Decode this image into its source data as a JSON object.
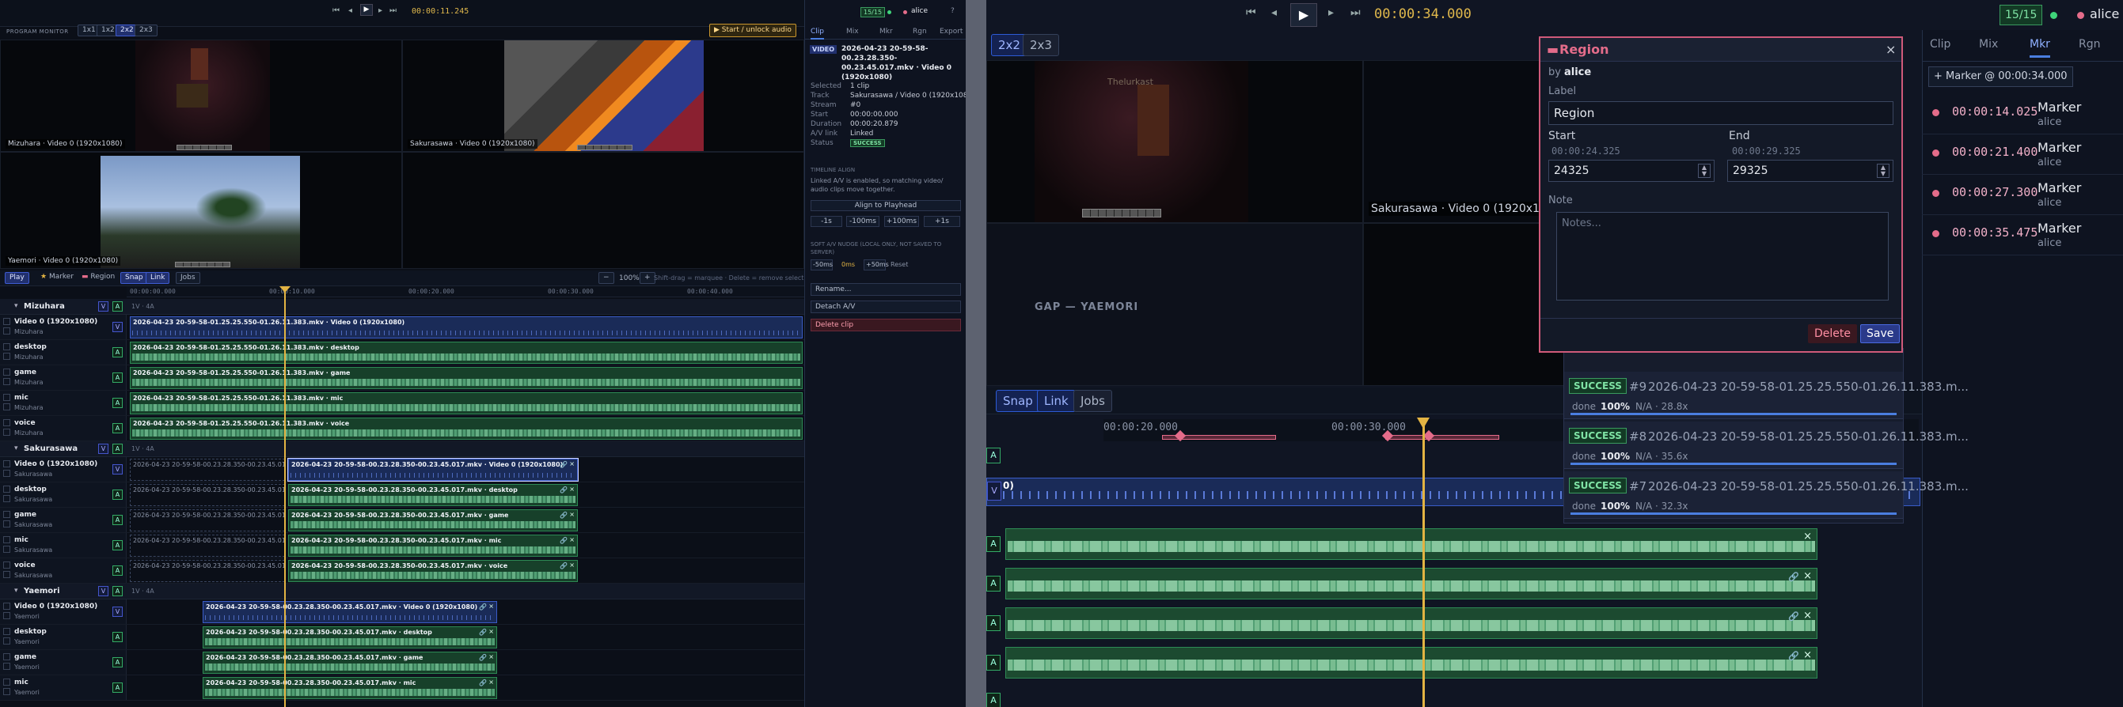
{
  "transport": {
    "timecode_left": "00:00:11.245",
    "timecode_right": "00:00:34.000",
    "count": "15/15",
    "user": "alice",
    "help": "?"
  },
  "monitor": {
    "label": "PROGRAM MONITOR",
    "layouts": [
      "1x1",
      "1x2",
      "2x2",
      "2x3"
    ],
    "start_btn": "▶ Start / unlock audio",
    "tiles": [
      "Mizuhara · Video 0 (1920x1080)",
      "Sakurasawa · Video 0 (1920x1080)",
      "Yaemori · Video 0 (1920x1080)"
    ],
    "gap_label": "GAP — YAEMORI",
    "magnified_tile": "Sakurasawa · Video 0 (1920x1080)",
    "game_hud": "Thelurkast"
  },
  "toolbar": {
    "play": "Play",
    "marker": "Marker",
    "region": "Region",
    "snap": "Snap",
    "link": "Link",
    "jobs": "Jobs",
    "zoom": "100%",
    "hint": "Shift-drag = marquee · Delete = remove selection"
  },
  "ruler": [
    "00:00:00.000",
    "00:00:10.000",
    "00:00:20.000",
    "00:00:30.000",
    "00:00:40.000"
  ],
  "groups": [
    {
      "name": "Mizuhara",
      "info": "1V · 4A",
      "tracks": [
        {
          "name": "Video 0 (1920x1080)",
          "sub": "Mizuhara",
          "kind": "V",
          "clip": "2026-04-23 20-59-58-01.25.25.550-01.26.11.383.mkv · Video 0 (1920x1080)"
        },
        {
          "name": "desktop",
          "sub": "Mizuhara",
          "kind": "A",
          "clip": "2026-04-23 20-59-58-01.25.25.550-01.26.11.383.mkv · desktop"
        },
        {
          "name": "game",
          "sub": "Mizuhara",
          "kind": "A",
          "clip": "2026-04-23 20-59-58-01.25.25.550-01.26.11.383.mkv · game"
        },
        {
          "name": "mic",
          "sub": "Mizuhara",
          "kind": "A",
          "clip": "2026-04-23 20-59-58-01.25.25.550-01.26.11.383.mkv · mic"
        },
        {
          "name": "voice",
          "sub": "Mizuhara",
          "kind": "A",
          "clip": "2026-04-23 20-59-58-01.25.25.550-01.26.11.383.mkv · voice"
        }
      ]
    },
    {
      "name": "Sakurasawa",
      "info": "1V · 4A",
      "tracks": [
        {
          "name": "Video 0 (1920x1080)",
          "sub": "Sakurasawa",
          "kind": "V",
          "ghost": "2026-04-23 20-59-58-00.23.28.350-00.23.45.017.mkv",
          "clip": "2026-04-23 20-59-58-00.23.28.350-00.23.45.017.mkv · Video 0 (1920x1080)"
        },
        {
          "name": "desktop",
          "sub": "Sakurasawa",
          "kind": "A",
          "ghost": "2026-04-23 20-59-58-00.23.28.350-00.23.45.017.mkv",
          "clip": "2026-04-23 20-59-58-00.23.28.350-00.23.45.017.mkv · desktop"
        },
        {
          "name": "game",
          "sub": "Sakurasawa",
          "kind": "A",
          "ghost": "2026-04-23 20-59-58-00.23.28.350-00.23.45.017.mkv",
          "clip": "2026-04-23 20-59-58-00.23.28.350-00.23.45.017.mkv · game"
        },
        {
          "name": "mic",
          "sub": "Sakurasawa",
          "kind": "A",
          "ghost": "2026-04-23 20-59-58-00.23.28.350-00.23.45.017.mkv",
          "clip": "2026-04-23 20-59-58-00.23.28.350-00.23.45.017.mkv · mic"
        },
        {
          "name": "voice",
          "sub": "Sakurasawa",
          "kind": "A",
          "ghost": "2026-04-23 20-59-58-00.23.28.350-00.23.45.017.mkv",
          "clip": "2026-04-23 20-59-58-00.23.28.350-00.23.45.017.mkv · voice"
        }
      ]
    },
    {
      "name": "Yaemori",
      "info": "1V · 4A",
      "tracks": [
        {
          "name": "Video 0 (1920x1080)",
          "sub": "Yaemori",
          "kind": "V",
          "clip": "2026-04-23 20-59-58-00.23.28.350-00.23.45.017.mkv · Video 0 (1920x1080)"
        },
        {
          "name": "desktop",
          "sub": "Yaemori",
          "kind": "A",
          "clip": "2026-04-23 20-59-58-00.23.28.350-00.23.45.017.mkv · desktop"
        },
        {
          "name": "game",
          "sub": "Yaemori",
          "kind": "A",
          "clip": "2026-04-23 20-59-58-00.23.28.350-00.23.45.017.mkv · game"
        },
        {
          "name": "mic",
          "sub": "Yaemori",
          "kind": "A",
          "clip": "2026-04-23 20-59-58-00.23.28.350-00.23.45.017.mkv · mic"
        }
      ]
    }
  ],
  "panel": {
    "tabs": [
      "Clip",
      "Mix",
      "Mkr",
      "Rgn",
      "Export"
    ],
    "badge": "VIDEO",
    "file": "2026-04-23 20-59-58-00.23.28.350-00.23.45.017.mkv · Video 0 (1920x1080)",
    "props": [
      [
        "Selected",
        "1 clip"
      ],
      [
        "Track",
        "Sakurasawa / Video 0 (1920x108..."
      ],
      [
        "Stream",
        "#0"
      ],
      [
        "Start",
        "00:00:00.000"
      ],
      [
        "Duration",
        "00:00:20.879"
      ],
      [
        "A/V link",
        "Linked"
      ],
      [
        "Status",
        "SUCCESS"
      ]
    ],
    "align_title": "TIMELINE ALIGN",
    "align_text": "Linked A/V is enabled, so matching video/ audio clips move together.",
    "align_btn": "Align to Playhead",
    "nudges": [
      "-1s",
      "-100ms",
      "+100ms",
      "+1s"
    ],
    "soft_title": "SOFT A/V NUDGE (LOCAL ONLY, NOT SAVED TO SERVER)",
    "soft": [
      "-50ms",
      "0ms",
      "+50ms",
      "Reset"
    ],
    "rename": "Rename...",
    "detach": "Detach A/V",
    "delete": "Delete clip"
  },
  "right": {
    "tabs": [
      "Clip",
      "Mix",
      "Mkr",
      "Rgn"
    ],
    "add_marker": "+ Marker @ 00:00:34.000",
    "markers": [
      {
        "t": "00:00:14.025",
        "n": "Marker",
        "u": "alice"
      },
      {
        "t": "00:00:21.400",
        "n": "Marker",
        "u": "alice"
      },
      {
        "t": "00:00:27.300",
        "n": "Marker",
        "u": "alice"
      },
      {
        "t": "00:00:35.475",
        "n": "Marker",
        "u": "alice"
      }
    ],
    "ruler": [
      "00:00:20.000",
      "00:00:30.000"
    ],
    "row_label_0": "0)"
  },
  "region": {
    "title": "Region",
    "by": "by",
    "user": "alice",
    "label_caption": "Label",
    "label_value": "Region",
    "start_caption": "Start",
    "start_tc": "00:00:24.325",
    "start_ms": "24325",
    "end_caption": "End",
    "end_tc": "00:00:29.325",
    "end_ms": "29325",
    "note_caption": "Note",
    "note_placeholder": "Notes...",
    "delete": "Delete",
    "save": "Save",
    "close": "×"
  },
  "jobs": [
    {
      "status": "SUCCESS",
      "id": "#9",
      "name": "2026-04-23 20-59-58-01.25.25.550-01.26.11.383.m...",
      "done": "done",
      "pct": "100%",
      "eta": "N/A · 28.8x"
    },
    {
      "status": "SUCCESS",
      "id": "#8",
      "name": "2026-04-23 20-59-58-01.25.25.550-01.26.11.383.m...",
      "done": "done",
      "pct": "100%",
      "eta": "N/A · 35.6x"
    },
    {
      "status": "SUCCESS",
      "id": "#7",
      "name": "2026-04-23 20-59-58-01.25.25.550-01.26.11.383.m...",
      "done": "done",
      "pct": "100%",
      "eta": "N/A · 32.3x"
    }
  ],
  "colors": {
    "accent": "#e3b443",
    "video": "#3a5cc8",
    "audio": "#2d8a55",
    "marker": "#e46c8a",
    "success": "#3a9a5f"
  }
}
